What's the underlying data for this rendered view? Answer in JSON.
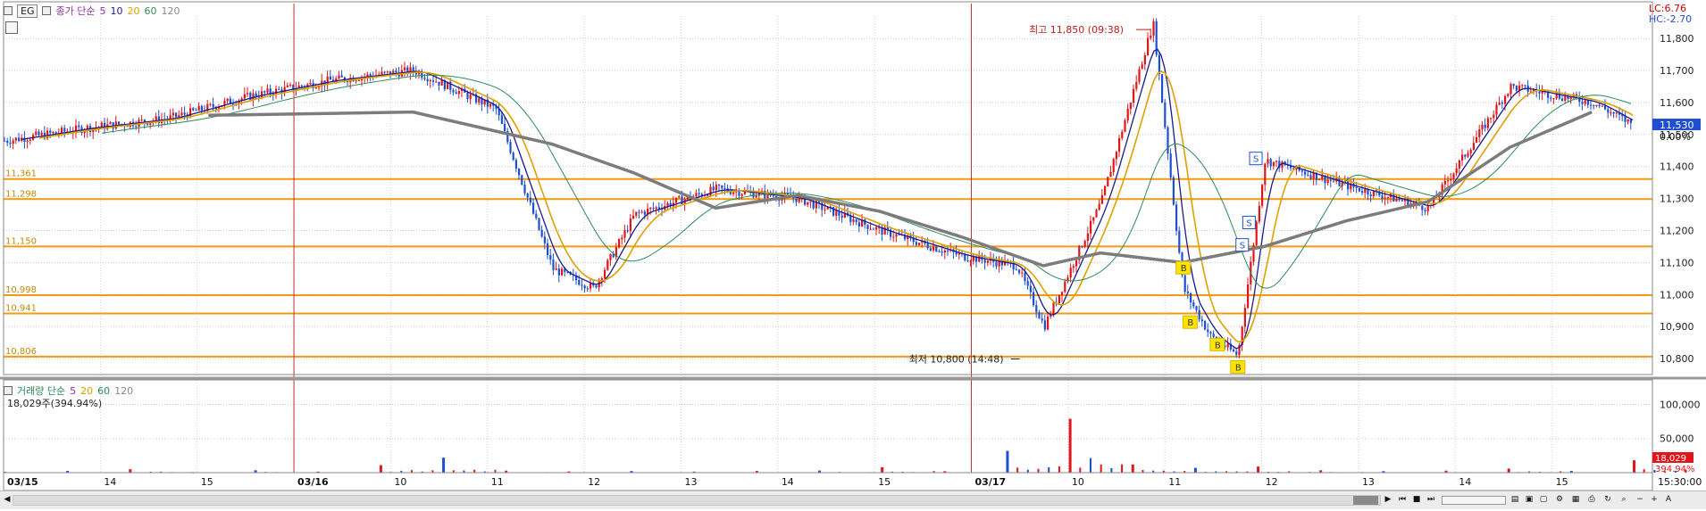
{
  "price_legend": {
    "code": "EG",
    "ma_label": "종가 단순",
    "periods": [
      "5",
      "10",
      "20",
      "60",
      "120"
    ],
    "colors": [
      "#8e2fa8",
      "#1a1a8c",
      "#e0a000",
      "#2e8b57",
      "#888888"
    ]
  },
  "volume_legend": {
    "label": "거래량 단순",
    "periods": [
      "5",
      "20",
      "60",
      "120"
    ],
    "colors": [
      "#8e2fa8",
      "#e0a000",
      "#2e8b57",
      "#888888"
    ],
    "current": "18,029주(394.94%)"
  },
  "corner_info": {
    "lc": "LC:6.76",
    "hc": "HC:-2.70"
  },
  "price_axis": {
    "ticks": [
      "11,800",
      "11,700",
      "11,600",
      "11,500",
      "11,400",
      "11,300",
      "11,200",
      "11,100",
      "11,000",
      "10,900",
      "10,800"
    ],
    "current_label": "11,530",
    "pct_label": "0.00%"
  },
  "volume_axis": {
    "ticks": [
      "100,000",
      "50,000"
    ],
    "current_label": "18,029",
    "pct_label": "394.94%"
  },
  "time_axis": {
    "labels": [
      "03/15",
      "14",
      "15",
      "03/16",
      "10",
      "11",
      "12",
      "13",
      "14",
      "15",
      "03/17",
      "10",
      "11",
      "12",
      "13",
      "14",
      "15"
    ],
    "end_time": "15:30:00"
  },
  "annotations": {
    "high": "최고 11,850 (09:38)",
    "low": "최저 10,800 (14:48)",
    "buy_marks": [
      "B",
      "B",
      "B",
      "B"
    ],
    "sell_marks": [
      "S",
      "S",
      "S"
    ]
  },
  "hlines": {
    "labels": [
      "11,361",
      "11,298",
      "11,150",
      "10,998",
      "10,941",
      "10,806"
    ],
    "color": "#f29a16"
  },
  "chart_data": {
    "type": "line",
    "title": "",
    "series": [
      {
        "name": "종가",
        "x": [
          "03/15 09:00",
          "03/15 10:00",
          "03/15 11:00",
          "03/15 12:00",
          "03/15 13:00",
          "03/15 14:00",
          "03/15 15:00",
          "03/16 09:00",
          "03/16 09:30",
          "03/16 10:00",
          "03/16 11:00",
          "03/16 12:00",
          "03/16 13:00",
          "03/16 14:00",
          "03/16 14:40",
          "03/16 15:00",
          "03/17 09:00",
          "03/17 09:38",
          "03/17 10:00",
          "03/17 10:20",
          "03/17 10:40",
          "03/17 11:00",
          "03/17 12:00",
          "03/17 13:00",
          "03/17 14:00",
          "03/17 15:00",
          "03/17 15:30"
        ],
        "values": [
          11480,
          11520,
          11550,
          11620,
          11670,
          11700,
          11580,
          11080,
          11020,
          11250,
          11330,
          11300,
          11200,
          11120,
          11090,
          10900,
          11290,
          11850,
          11020,
          10870,
          10810,
          11420,
          11340,
          11270,
          11650,
          11600,
          11530
        ]
      },
      {
        "name": "120",
        "x": [
          "03/15 11:30",
          "03/15 14:00",
          "03/16 09:00",
          "03/16 10:00",
          "03/16 11:00",
          "03/16 12:00",
          "03/16 13:00",
          "03/16 14:00",
          "03/16 15:00",
          "03/17 09:00",
          "03/17 10:00",
          "03/17 11:00",
          "03/17 12:00",
          "03/17 13:00",
          "03/17 14:00",
          "03/17 15:00"
        ],
        "values": [
          11560,
          11570,
          11470,
          11380,
          11270,
          11310,
          11260,
          11180,
          11090,
          11130,
          11100,
          11150,
          11230,
          11290,
          11460,
          11570
        ]
      }
    ],
    "volume": {
      "values": [
        1200,
        2600,
        5000,
        900,
        3500,
        1500,
        11000,
        22000,
        3000,
        1800,
        2400,
        1500,
        2500,
        3100,
        8000,
        2100,
        32000,
        79000,
        12000,
        7000,
        9000,
        3500,
        2200,
        3000,
        6000,
        2500,
        18029
      ]
    },
    "ylim": [
      10750,
      11870
    ],
    "volume_ylim": [
      0,
      115000
    ],
    "grid": true
  }
}
